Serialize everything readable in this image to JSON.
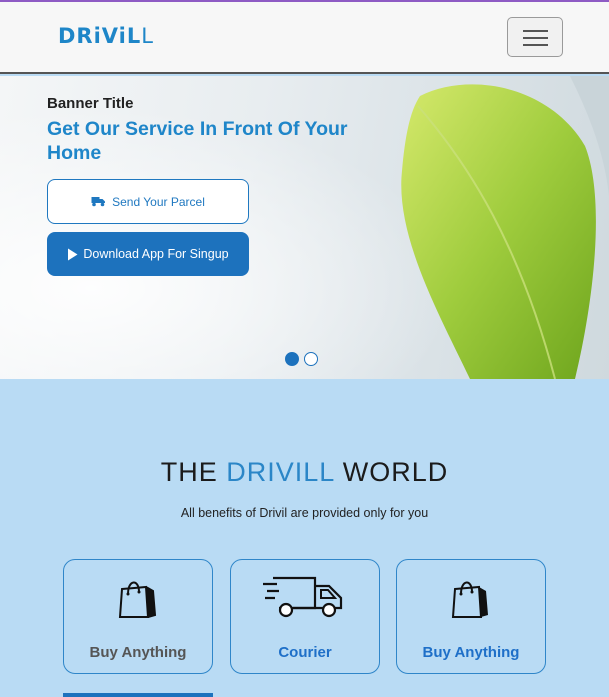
{
  "header": {
    "logo_text_bold": "DRiViL",
    "logo_text_light": "L",
    "menu_icon": "hamburger-icon"
  },
  "banner": {
    "subtitle": "Banner Title",
    "title": "Get Our Service In Front Of Your Home",
    "send_parcel_label": "Send Your Parcel",
    "send_parcel_icon": "truck-icon",
    "download_app_label": "Download App For Singup",
    "download_app_icon": "play-icon",
    "slides": 2,
    "active_slide": 1
  },
  "section": {
    "title_pre": "THE ",
    "title_highlight": "DRIVILL",
    "title_post": " WORLD",
    "subtitle": "All benefits of Drivil are provided only for you"
  },
  "cards": [
    {
      "label": "Buy Anything",
      "icon": "shopping-bag-icon"
    },
    {
      "label": "Courier",
      "icon": "delivery-truck-icon"
    },
    {
      "label": "Buy Anything",
      "icon": "shopping-bag-icon"
    }
  ],
  "colors": {
    "brand": "#1e86c8",
    "button": "#1d72bd",
    "section_bg": "#b9dbf4"
  }
}
